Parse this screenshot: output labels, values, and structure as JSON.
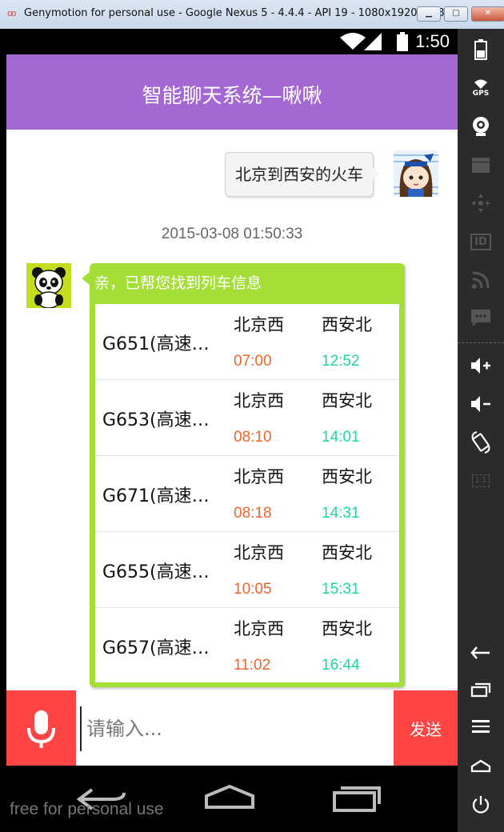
{
  "window": {
    "title": "Genymotion for personal use - Google Nexus 5 - 4.4.4 - API 19 - 1080x1920 (1080...",
    "minimize": "▁",
    "maximize": "□",
    "close": "✕"
  },
  "status_bar": {
    "time": "1:50"
  },
  "header": {
    "title": "智能聊天系统—啾啾"
  },
  "chat": {
    "user_message": "北京到西安的火车",
    "timestamp": "2015-03-08 01:50:33",
    "bot_message": "亲，已帮您找到列车信息",
    "trains": [
      {
        "name": "G651(高速…",
        "from": "北京西",
        "to": "西安北",
        "depart": "07:00",
        "arrive": "12:52"
      },
      {
        "name": "G653(高速…",
        "from": "北京西",
        "to": "西安北",
        "depart": "08:10",
        "arrive": "14:01"
      },
      {
        "name": "G671(高速…",
        "from": "北京西",
        "to": "西安北",
        "depart": "08:18",
        "arrive": "14:31"
      },
      {
        "name": "G655(高速…",
        "from": "北京西",
        "to": "西安北",
        "depart": "10:05",
        "arrive": "15:31"
      },
      {
        "name": "G657(高速…",
        "from": "北京西",
        "to": "西安北",
        "depart": "11:02",
        "arrive": "16:44"
      }
    ]
  },
  "input_bar": {
    "placeholder": "请输入...",
    "send_label": "发送"
  },
  "watermark": "free for personal use",
  "sidebar": {
    "gps_label": "GPS",
    "id_label": "ID",
    "scale_label": "1:1"
  },
  "colors": {
    "header": "#a468d2",
    "bot_bubble": "#a5de37",
    "send_button": "#ff4444",
    "depart_time": "#f0642d",
    "arrive_time": "#1fd6a0"
  }
}
